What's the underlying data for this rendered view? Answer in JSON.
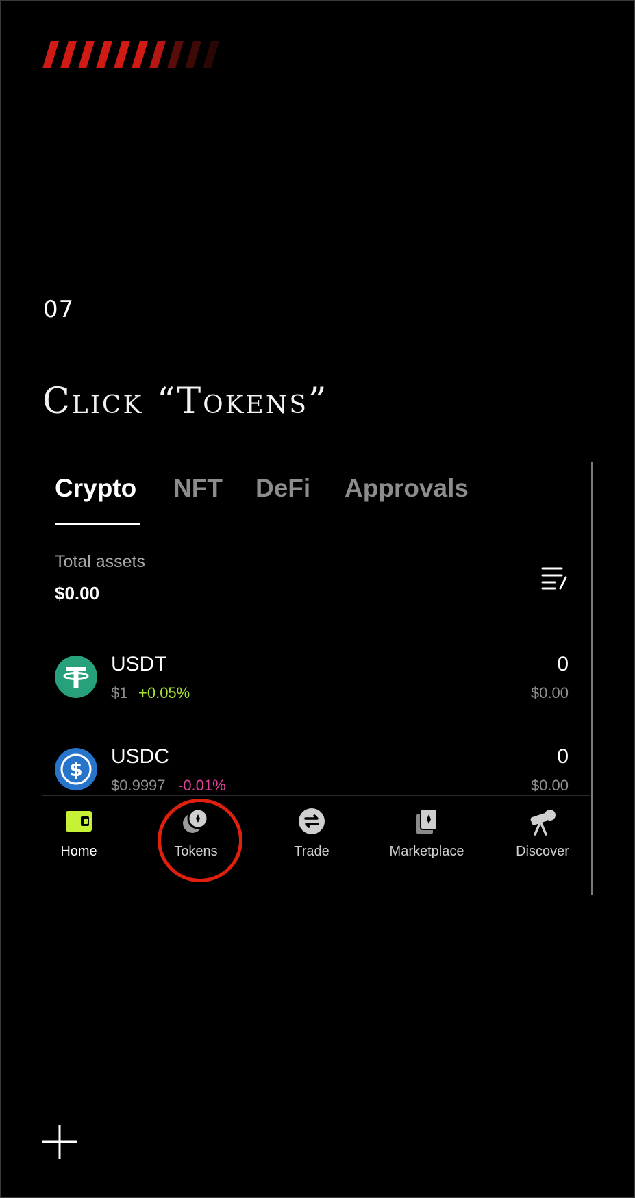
{
  "step": {
    "number": "07",
    "title": "Click “Tokens”"
  },
  "tabs": [
    {
      "label": "Crypto",
      "active": true
    },
    {
      "label": "NFT",
      "active": false
    },
    {
      "label": "DeFi",
      "active": false
    },
    {
      "label": "Approvals",
      "active": false
    }
  ],
  "total_assets": {
    "label": "Total assets",
    "value": "$0.00"
  },
  "tokens": [
    {
      "symbol": "USDT",
      "price": "$1",
      "change": "+0.05%",
      "change_color": "#a6e22e",
      "amount": "0",
      "value": "$0.00",
      "icon": "tether-logo-icon",
      "logo_color": "#26a17b"
    },
    {
      "symbol": "USDC",
      "price": "$0.9997",
      "change": "-0.01%",
      "change_color": "#e0409a",
      "amount": "0",
      "value": "$0.00",
      "icon": "usdc-logo-icon",
      "logo_color": "#2775ca"
    }
  ],
  "bottom_nav": [
    {
      "label": "Home",
      "icon": "wallet-icon"
    },
    {
      "label": "Tokens",
      "icon": "tokens-icon",
      "highlighted": true
    },
    {
      "label": "Trade",
      "icon": "swap-icon"
    },
    {
      "label": "Marketplace",
      "icon": "marketplace-icon"
    },
    {
      "label": "Discover",
      "icon": "telescope-icon"
    }
  ],
  "colors": {
    "background": "#000000",
    "accent_stripes": "#d01a14",
    "highlight_circle": "#e0200f",
    "home_icon": "#c6f135"
  }
}
